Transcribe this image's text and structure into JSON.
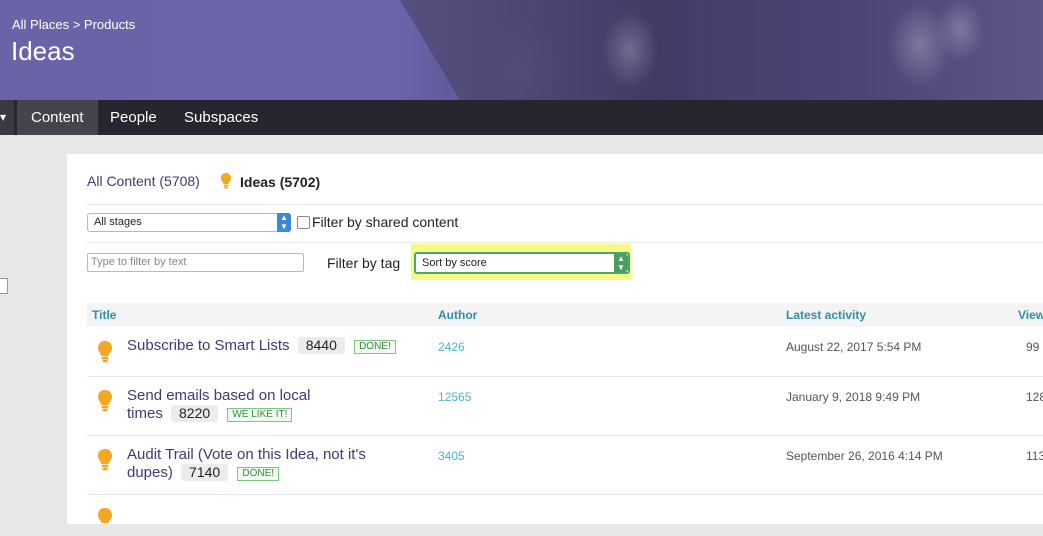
{
  "header": {
    "breadcrumb": [
      "All Places",
      ">",
      "Products"
    ],
    "title": "Ideas"
  },
  "nav": {
    "tabs": [
      {
        "label": "Content",
        "active": true
      },
      {
        "label": "People",
        "active": false
      },
      {
        "label": "Subspaces",
        "active": false
      }
    ]
  },
  "content_filters": {
    "all_content": "All Content (5708)",
    "ideas": "Ideas (5702)"
  },
  "filters": {
    "stage_select": "All stages",
    "shared_label": "Filter by shared content",
    "text_filter_placeholder": "Type to filter by text",
    "filter_by_tag": "Filter by tag",
    "sort_select": "Sort by score"
  },
  "table": {
    "columns": {
      "title": "Title",
      "author": "Author",
      "latest_activity": "Latest activity",
      "views": "View"
    },
    "rows": [
      {
        "title_line1": "Subscribe to Smart Lists",
        "title_line2": "",
        "score": "8440",
        "status": "DONE!",
        "author": "2426",
        "activity": "August 22, 2017 5:54 PM",
        "views": "99"
      },
      {
        "title_line1": "Send emails based on local",
        "title_line2": "times",
        "score": "8220",
        "status": "WE LIKE IT!",
        "author": "12565",
        "activity": "January 9, 2018 9:49 PM",
        "views": "128"
      },
      {
        "title_line1": "Audit Trail (Vote on this Idea, not it's",
        "title_line2": "dupes)",
        "score": "7140",
        "status": "DONE!",
        "author": "3405",
        "activity": "September 26, 2016 4:14 PM",
        "views": "113"
      }
    ]
  },
  "colors": {
    "banner": "#6a63a8",
    "nav": "#27262f",
    "link": "#3c3a78",
    "accent_teal": "#2e8fa6",
    "bulb": "#f5a623",
    "highlight": "#f8f78a"
  }
}
